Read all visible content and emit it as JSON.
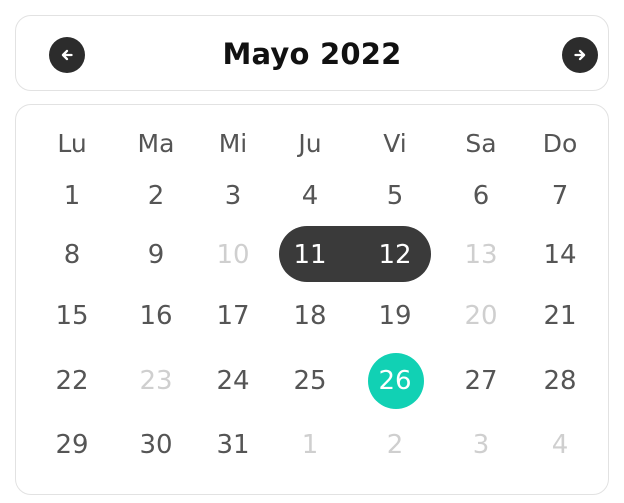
{
  "header": {
    "title": "Mayo 2022",
    "prev_icon": "arrow-left-icon",
    "next_icon": "arrow-right-icon"
  },
  "colors": {
    "range_highlight": "#3a3a3a",
    "today_highlight": "#11d1b4",
    "text_normal": "#555555",
    "text_faded": "#cfcfcf",
    "nav_button": "#2c2c2c"
  },
  "weekdays": [
    "Lu",
    "Ma",
    "Mi",
    "Ju",
    "Vi",
    "Sa",
    "Do"
  ],
  "weeks": [
    [
      {
        "label": "1",
        "state": "normal"
      },
      {
        "label": "2",
        "state": "normal"
      },
      {
        "label": "3",
        "state": "normal"
      },
      {
        "label": "4",
        "state": "normal"
      },
      {
        "label": "5",
        "state": "normal"
      },
      {
        "label": "6",
        "state": "normal"
      },
      {
        "label": "7",
        "state": "normal"
      }
    ],
    [
      {
        "label": "8",
        "state": "normal"
      },
      {
        "label": "9",
        "state": "normal"
      },
      {
        "label": "10",
        "state": "disabled"
      },
      {
        "label": "11",
        "state": "range"
      },
      {
        "label": "12",
        "state": "range"
      },
      {
        "label": "13",
        "state": "disabled"
      },
      {
        "label": "14",
        "state": "normal"
      }
    ],
    [
      {
        "label": "15",
        "state": "normal"
      },
      {
        "label": "16",
        "state": "normal"
      },
      {
        "label": "17",
        "state": "normal"
      },
      {
        "label": "18",
        "state": "normal"
      },
      {
        "label": "19",
        "state": "normal"
      },
      {
        "label": "20",
        "state": "disabled"
      },
      {
        "label": "21",
        "state": "normal"
      }
    ],
    [
      {
        "label": "22",
        "state": "normal"
      },
      {
        "label": "23",
        "state": "disabled"
      },
      {
        "label": "24",
        "state": "normal"
      },
      {
        "label": "25",
        "state": "normal"
      },
      {
        "label": "26",
        "state": "today"
      },
      {
        "label": "27",
        "state": "normal"
      },
      {
        "label": "28",
        "state": "normal"
      }
    ],
    [
      {
        "label": "29",
        "state": "normal"
      },
      {
        "label": "30",
        "state": "normal"
      },
      {
        "label": "31",
        "state": "normal"
      },
      {
        "label": "1",
        "state": "outside"
      },
      {
        "label": "2",
        "state": "outside"
      },
      {
        "label": "3",
        "state": "outside"
      },
      {
        "label": "4",
        "state": "outside"
      }
    ]
  ]
}
